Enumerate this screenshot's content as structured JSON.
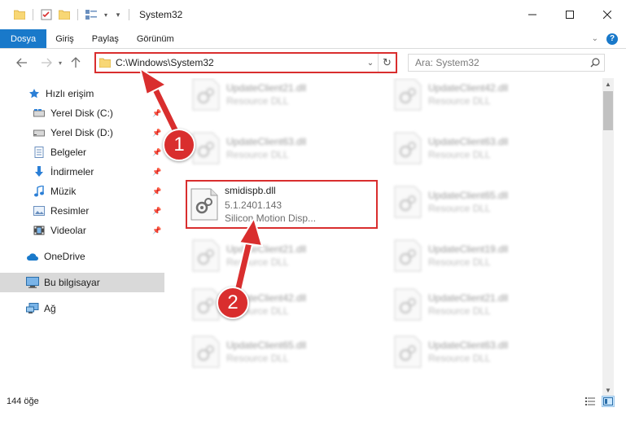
{
  "window": {
    "title": "System32",
    "minimize_icon": "minimize-icon",
    "maximize_icon": "maximize-icon",
    "close_icon": "close-icon"
  },
  "ribbon": {
    "tabs": [
      "Dosya",
      "Giriş",
      "Paylaş",
      "Görünüm"
    ]
  },
  "navigation": {
    "address": "C:\\Windows\\System32",
    "search_placeholder": "Ara: System32"
  },
  "sidebar": {
    "items": [
      {
        "label": "Hızlı erişim",
        "icon": "star-icon"
      },
      {
        "label": "Yerel Disk (C:)",
        "icon": "drive-icon",
        "pinned": true
      },
      {
        "label": "Yerel Disk (D:)",
        "icon": "drive-icon",
        "pinned": true
      },
      {
        "label": "Belgeler",
        "icon": "documents-icon",
        "pinned": true
      },
      {
        "label": "İndirmeler",
        "icon": "download-icon",
        "pinned": true
      },
      {
        "label": "Müzik",
        "icon": "music-icon",
        "pinned": true
      },
      {
        "label": "Resimler",
        "icon": "pictures-icon",
        "pinned": true
      },
      {
        "label": "Videolar",
        "icon": "videos-icon",
        "pinned": true
      },
      {
        "label": "OneDrive",
        "icon": "cloud-icon"
      },
      {
        "label": "Bu bilgisayar",
        "icon": "computer-icon",
        "selected": true
      },
      {
        "label": "Ağ",
        "icon": "network-icon"
      }
    ]
  },
  "files": {
    "highlighted": {
      "name": "smidispb.dll",
      "version": "5.1.2401.143",
      "description": "Silicon Motion Disp..."
    },
    "left_column": [
      {
        "name": "UpdateClient21.dll",
        "type": "Resource DLL"
      },
      {
        "name": "UpdateClient63.dll",
        "type": "Resource DLL"
      },
      {
        "name": "UpdateClient21.dll",
        "type": "Resource DLL"
      },
      {
        "name": "UpdateClient42.dll",
        "type": "Resource DLL"
      },
      {
        "name": "UpdateClient65.dll",
        "type": "Resource DLL"
      }
    ],
    "right_column": [
      {
        "name": "UpdateClient42.dll",
        "type": "Resource DLL"
      },
      {
        "name": "UpdateClient63.dll",
        "type": "Resource DLL"
      },
      {
        "name": "UpdateClient65.dll",
        "type": "Resource DLL"
      },
      {
        "name": "UpdateClient19.dll",
        "type": "Resource DLL"
      },
      {
        "name": "UpdateClient21.dll",
        "type": "Resource DLL"
      },
      {
        "name": "UpdateClient63.dll",
        "type": "Resource DLL"
      }
    ]
  },
  "status": {
    "item_count": "144 öğe"
  },
  "annotations": {
    "step1": "1",
    "step2": "2",
    "color": "#d92e2e"
  }
}
